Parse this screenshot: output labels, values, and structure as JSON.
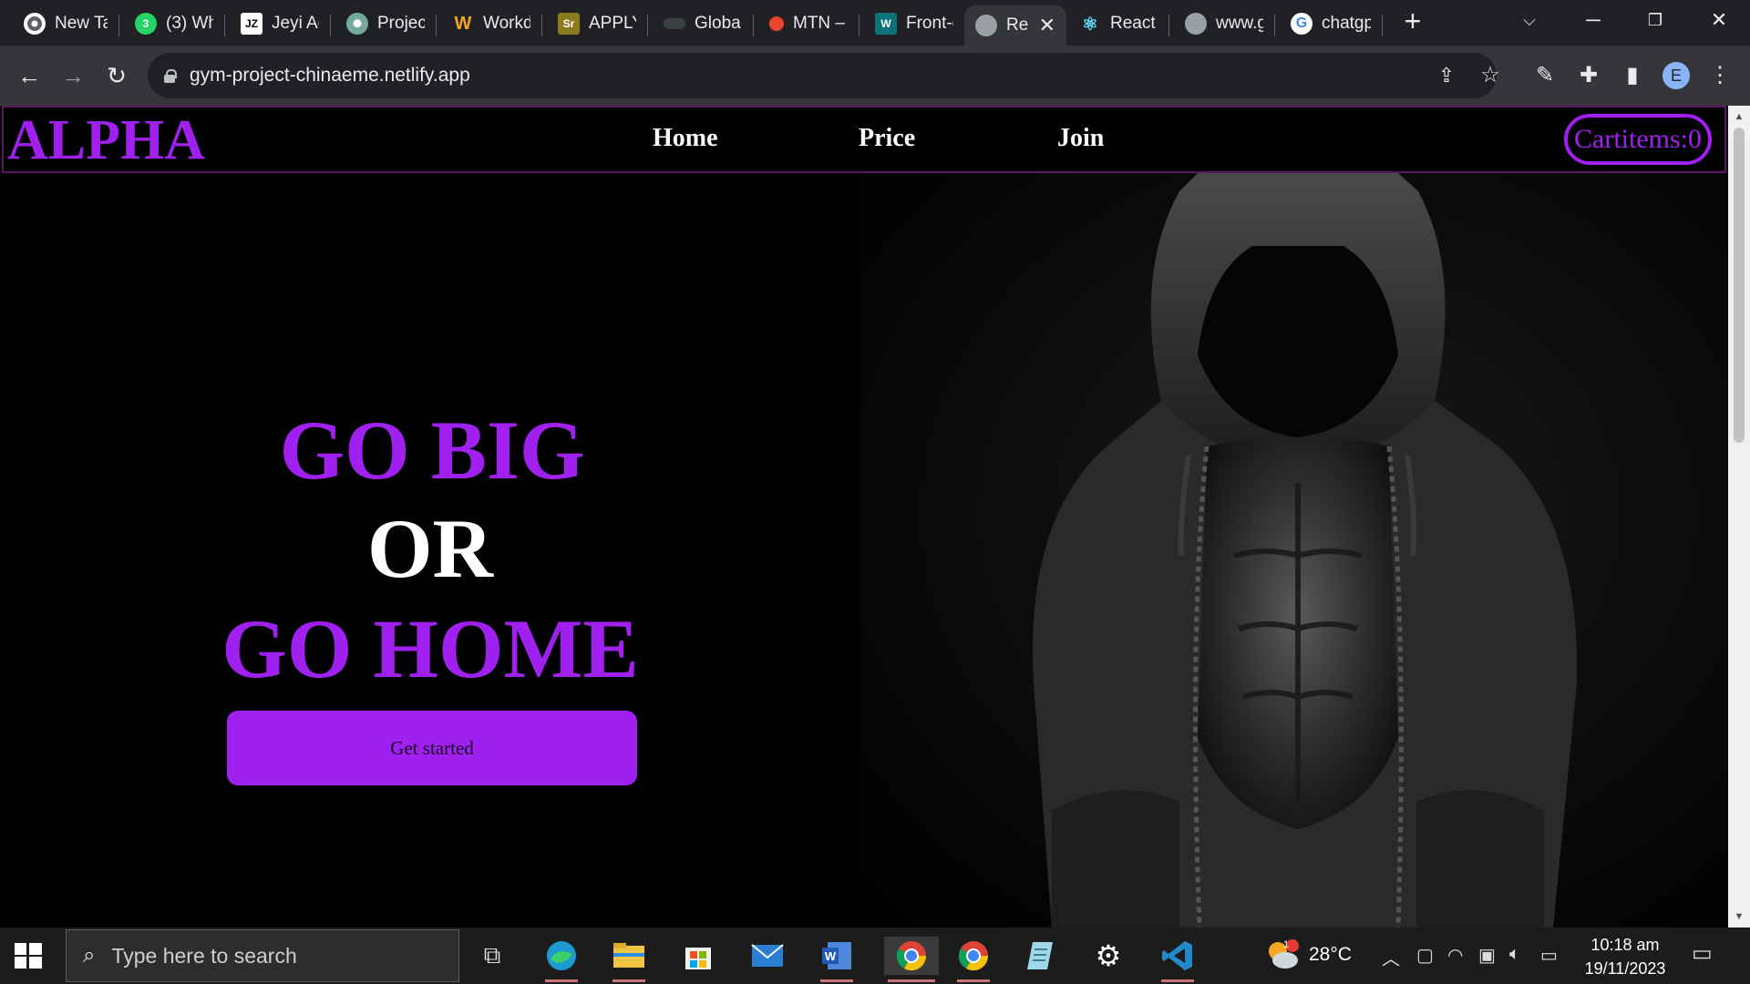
{
  "browser": {
    "tabs": [
      {
        "label": "New Ta",
        "icon": "chrome-icon",
        "color": "#5f6368"
      },
      {
        "label": "(3) Wh",
        "icon": "whatsapp-icon",
        "color": "#25d366"
      },
      {
        "label": "Jeyi Ad",
        "icon": "jeyi-icon",
        "color": "#ffffff"
      },
      {
        "label": "Project",
        "icon": "openai-icon",
        "color": "#74aa9c"
      },
      {
        "label": "Workd",
        "icon": "workday-icon",
        "color": "#0875e1"
      },
      {
        "label": "APPLY:",
        "icon": "sr-icon",
        "color": "#8c7b1e"
      },
      {
        "label": "Global",
        "icon": "global-icon",
        "color": "#3c4043"
      },
      {
        "label": "MTN –",
        "icon": "mtn-icon",
        "color": "#e8452c"
      },
      {
        "label": "Front-e",
        "icon": "frontend-icon",
        "color": "#0d7377"
      },
      {
        "label": "Re",
        "icon": "globe-icon",
        "color": "#9aa0a6"
      },
      {
        "label": "React /",
        "icon": "react-icon",
        "color": "#61dafb"
      },
      {
        "label": "www.g",
        "icon": "globe-icon",
        "color": "#9aa0a6"
      },
      {
        "label": "chatgp",
        "icon": "google-icon",
        "color": "#4285f4"
      }
    ],
    "url": "gym-project-chinaeme.netlify.app",
    "profile_initial": "E"
  },
  "site": {
    "logo": "ALPHA",
    "nav": [
      "Home",
      "Price",
      "Join"
    ],
    "cart_label": "Cartitems:0",
    "hero": {
      "line1": "GO BIG",
      "line2": "OR",
      "line3": "GO HOME",
      "cta": "Get started"
    }
  },
  "taskbar": {
    "search_placeholder": "Type here to search",
    "weather": "28°C",
    "weather_badge": "1",
    "time": "10:18 am",
    "date": "19/11/2023"
  }
}
